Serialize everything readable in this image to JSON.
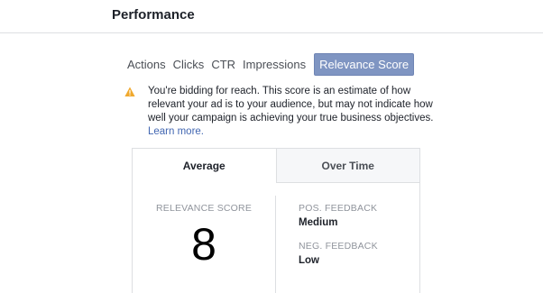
{
  "header": {
    "title": "Performance"
  },
  "tabs": [
    {
      "label": "Actions"
    },
    {
      "label": "Clicks"
    },
    {
      "label": "CTR"
    },
    {
      "label": "Impressions"
    },
    {
      "label": "Relevance Score",
      "active": true
    }
  ],
  "notice": {
    "icon": "warning-icon",
    "text": "You're bidding for reach. This score is an estimate of how relevant your ad is to your audience, but may not indicate how well your campaign is achieving your true business objectives.",
    "link": "Learn more."
  },
  "panel": {
    "tabs": [
      {
        "label": "Average",
        "active": true
      },
      {
        "label": "Over Time"
      }
    ],
    "score_label": "RELEVANCE SCORE",
    "score_value": "8",
    "pos_feedback_label": "POS. FEEDBACK",
    "pos_feedback_value": "Medium",
    "neg_feedback_label": "NEG. FEEDBACK",
    "neg_feedback_value": "Low"
  },
  "colors": {
    "active_tab": "#7f95c2",
    "link": "#4267b2",
    "warning": "#f0a92e",
    "muted_text": "#90949c"
  }
}
